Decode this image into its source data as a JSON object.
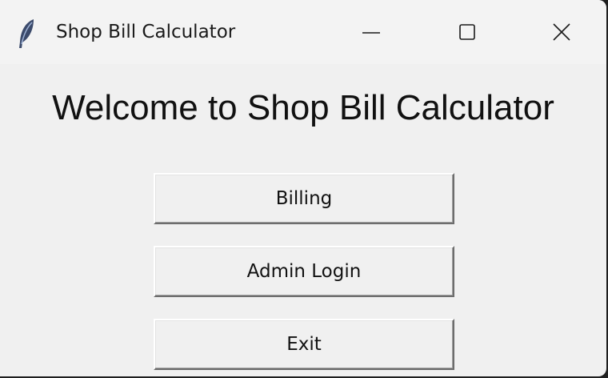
{
  "window": {
    "title": "Shop Bill Calculator",
    "icon": "feather-icon",
    "controls": {
      "minimize": "minimize-icon",
      "maximize": "maximize-icon",
      "close": "close-icon"
    }
  },
  "main": {
    "heading": "Welcome to Shop Bill Calculator",
    "buttons": {
      "billing": "Billing",
      "admin_login": "Admin Login",
      "exit": "Exit"
    }
  },
  "colors": {
    "window_background": "#f0f0f0",
    "text": "#111111"
  }
}
